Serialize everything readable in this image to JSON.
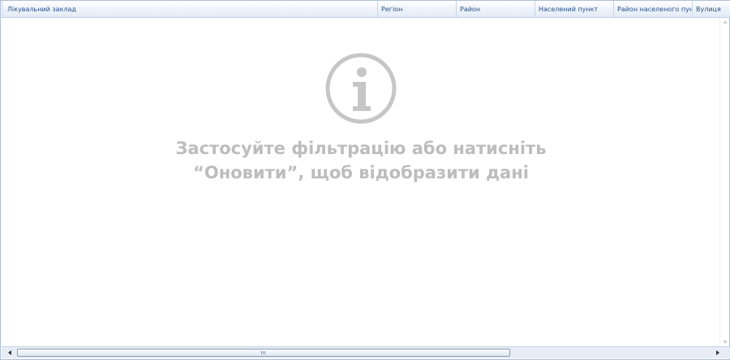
{
  "grid": {
    "columns": [
      {
        "label": "Лікувальний заклад"
      },
      {
        "label": "Регіон"
      },
      {
        "label": "Район"
      },
      {
        "label": "Населений пункт"
      },
      {
        "label": "Район населеного пункт"
      },
      {
        "label": "Вулиця"
      }
    ]
  },
  "empty_state": {
    "icon": "info-icon",
    "line1": "Застосуйте фільтрацію або натисніть",
    "line2": "“Оновити”, щоб відобразити дані"
  },
  "colors": {
    "header_text": "#2b4f86",
    "empty_text": "#bdbdbd",
    "frame_border": "#aebfd6"
  }
}
